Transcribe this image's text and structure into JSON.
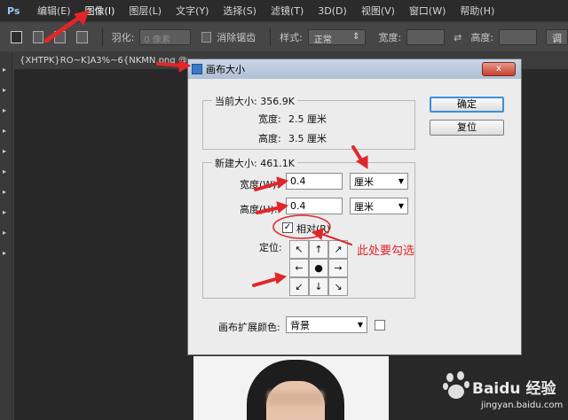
{
  "menubar": {
    "app_logo": "Ps",
    "items": [
      "编辑(E)",
      "图像(I)",
      "图层(L)",
      "文字(Y)",
      "选择(S)",
      "滤镜(T)",
      "3D(D)",
      "视图(V)",
      "窗口(W)",
      "帮助(H)"
    ]
  },
  "optionsbar": {
    "feather_label": "羽化:",
    "feather_value": "0 像素",
    "antialias_label": "消除锯齿",
    "style_label": "样式:",
    "style_value": "正常",
    "width_label": "宽度:",
    "height_label": "高度:",
    "refine_label": "调"
  },
  "document": {
    "tab_title": "{XHTPK}RO~K]A3%~6{NKMN.png @"
  },
  "dialog": {
    "title": "画布大小",
    "close_glyph": "x",
    "current_size": {
      "group_title": "当前大小: 356.9K",
      "width_label": "宽度:",
      "width_value": "2.5 厘米",
      "height_label": "高度:",
      "height_value": "3.5 厘米"
    },
    "new_size": {
      "group_title": "新建大小: 461.1K",
      "width_label": "宽度(W):",
      "width_value": "0.4",
      "width_unit": "厘米",
      "height_label": "高度(H):",
      "height_value": "0.4",
      "height_unit": "厘米",
      "relative_label": "相对(R)",
      "relative_checked": true,
      "anchor_label": "定位:",
      "anchor_cells": [
        "↖",
        "↑",
        "↗",
        "←",
        "●",
        "→",
        "↙",
        "↓",
        "↘"
      ]
    },
    "extension_color_label": "画布扩展颜色:",
    "extension_color_value": "背景",
    "ok_label": "确定",
    "reset_label": "复位"
  },
  "annotation": {
    "text": "此处要勾选",
    "color": "#e0262a"
  },
  "watermark": {
    "brand": "Baidu 经验",
    "url": "jingyan.baidu.com"
  }
}
